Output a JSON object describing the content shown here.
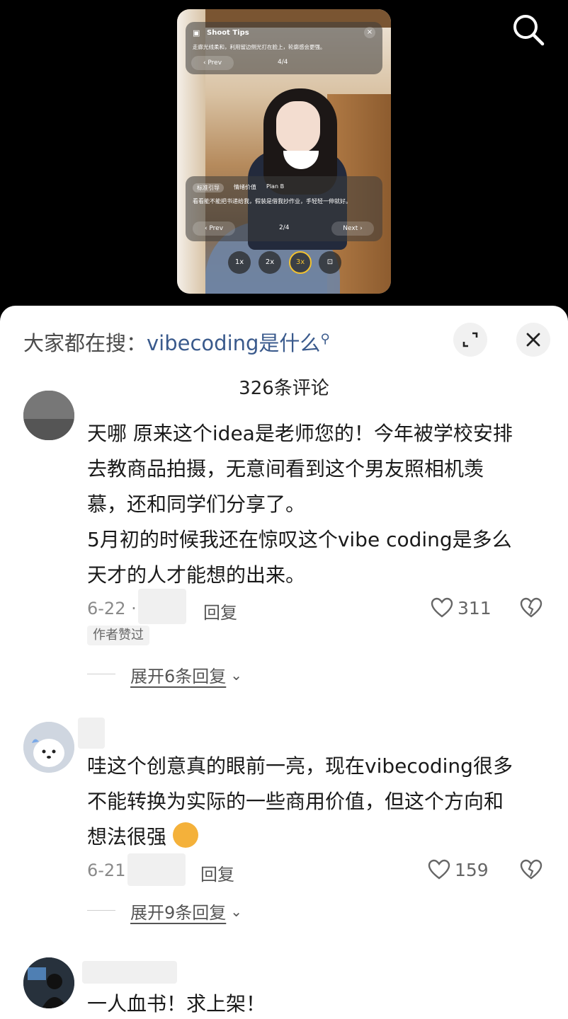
{
  "video": {
    "tips": {
      "title": "Shoot Tips",
      "body": "走廊光线柔和，利用留边侧光打在脸上，轮廓感会更强。",
      "prev": "‹ Prev",
      "page": "4/4",
      "close": "×"
    },
    "guide": {
      "tab1": "标准引导",
      "tab2": "情绪价值",
      "tab3": "Plan B",
      "body": "看看能不能把书递给我，假装是借我抄作业，手轻轻一伸就好。",
      "prev": "‹ Prev",
      "page": "2/4",
      "next": "Next ›"
    },
    "zoom": [
      "1x",
      "2x",
      "3x"
    ],
    "zoom_selected": "3x"
  },
  "sheet": {
    "hot_search_prefix": "大家都在搜：",
    "hot_search_query": "vibecoding是什么",
    "comment_count": "326条评论"
  },
  "comments": [
    {
      "text": "天哪 原来这个idea是老师您的！今年被学校安排去教商品拍摄，无意间看到这个男友照相机羡慕，还和同学们分享了。\n5月初的时候我还在惊叹这个vibe coding是多么天才的人才能想的出来。",
      "line1": "天哪 原来这个idea是老师您的！今年被学校安排",
      "line2": "去教商品拍摄，无意间看到这个男友照相机羡",
      "line3": "慕，还和同学们分享了。",
      "line4": "5月初的时候我还在惊叹这个vibe coding是多么",
      "line5": "天才的人才能想的出来。",
      "date": "6-22 ·",
      "reply": "回复",
      "likes": "311",
      "badge": "作者赞过",
      "expand": "展开6条回复"
    },
    {
      "line1": "哇这个创意真的眼前一亮，现在vibecoding很多",
      "line2": "不能转换为实际的一些商用价值，但这个方向和",
      "line3": "想法很强",
      "date": "6-21",
      "reply": "回复",
      "likes": "159",
      "expand": "展开9条回复"
    },
    {
      "line1": "一人血书！求上架！"
    }
  ],
  "colors": {
    "link": "#3a5a8c",
    "highlight": "#f2c230"
  }
}
